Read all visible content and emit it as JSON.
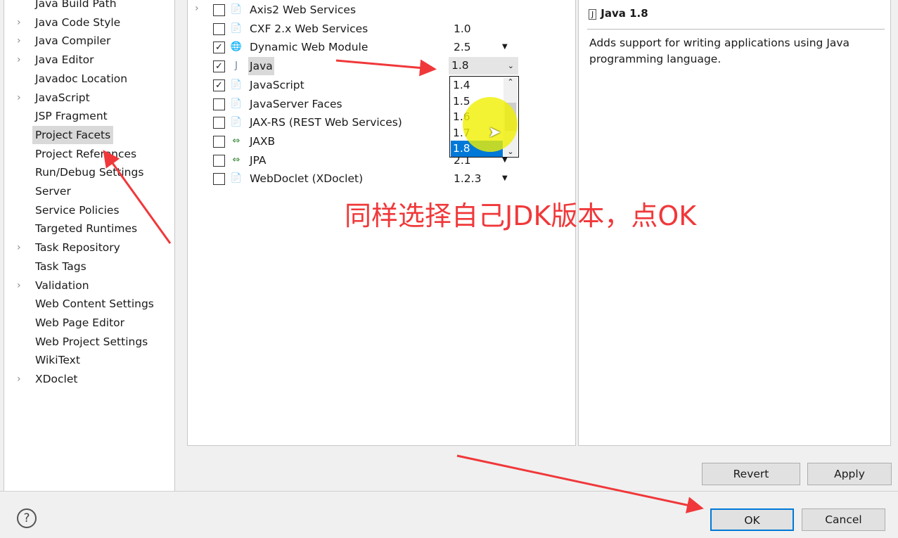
{
  "sidebar": {
    "items": [
      {
        "label": "Java Build Path",
        "expandable": false
      },
      {
        "label": "Java Code Style",
        "expandable": true
      },
      {
        "label": "Java Compiler",
        "expandable": true
      },
      {
        "label": "Java Editor",
        "expandable": true
      },
      {
        "label": "Javadoc Location",
        "expandable": false
      },
      {
        "label": "JavaScript",
        "expandable": true
      },
      {
        "label": "JSP Fragment",
        "expandable": false
      },
      {
        "label": "Project Facets",
        "expandable": false,
        "selected": true
      },
      {
        "label": "Project References",
        "expandable": false
      },
      {
        "label": "Run/Debug Settings",
        "expandable": false
      },
      {
        "label": "Server",
        "expandable": false
      },
      {
        "label": "Service Policies",
        "expandable": false
      },
      {
        "label": "Targeted Runtimes",
        "expandable": false
      },
      {
        "label": "Task Repository",
        "expandable": true
      },
      {
        "label": "Task Tags",
        "expandable": false
      },
      {
        "label": "Validation",
        "expandable": true
      },
      {
        "label": "Web Content Settings",
        "expandable": false
      },
      {
        "label": "Web Page Editor",
        "expandable": false
      },
      {
        "label": "Web Project Settings",
        "expandable": false
      },
      {
        "label": "WikiText",
        "expandable": false
      },
      {
        "label": "XDoclet",
        "expandable": true
      }
    ]
  },
  "facets": [
    {
      "name": "Axis2 Web Services",
      "checked": false,
      "version": "",
      "dropdown": false,
      "expandable": true,
      "icon": "document-icon"
    },
    {
      "name": "CXF 2.x Web Services",
      "checked": false,
      "version": "1.0",
      "dropdown": false,
      "icon": "document-icon"
    },
    {
      "name": "Dynamic Web Module",
      "checked": true,
      "version": "2.5",
      "dropdown": true,
      "icon": "web-module-locked-icon"
    },
    {
      "name": "Java",
      "checked": true,
      "version": "",
      "dropdown": false,
      "icon": "java-locked-icon",
      "selected": true
    },
    {
      "name": "JavaScript",
      "checked": true,
      "version": "",
      "dropdown": false,
      "icon": "document-locked-icon"
    },
    {
      "name": "JavaServer Faces",
      "checked": false,
      "version": "",
      "dropdown": false,
      "icon": "document-icon"
    },
    {
      "name": "JAX-RS (REST Web Services)",
      "checked": false,
      "version": "",
      "dropdown": false,
      "icon": "document-icon"
    },
    {
      "name": "JAXB",
      "checked": false,
      "version": "",
      "dropdown": false,
      "icon": "bidirectional-arrow-icon"
    },
    {
      "name": "JPA",
      "checked": false,
      "version": "2.1",
      "dropdown": true,
      "icon": "bidirectional-arrow-icon"
    },
    {
      "name": "WebDoclet (XDoclet)",
      "checked": false,
      "version": "1.2.3",
      "dropdown": true,
      "icon": "document-icon"
    }
  ],
  "java_version": {
    "selected": "1.8",
    "options": [
      "1.4",
      "1.5",
      "1.6",
      "1.7",
      "1.8"
    ]
  },
  "details": {
    "title": "Java 1.8",
    "description": "Adds support for writing applications using Java programming language."
  },
  "buttons": {
    "revert": "Revert",
    "apply": "Apply",
    "ok": "OK",
    "cancel": "Cancel",
    "help": "?"
  },
  "annotation": {
    "text": "同样选择自己JDK版本，点OK",
    "color": "#f0383a"
  }
}
